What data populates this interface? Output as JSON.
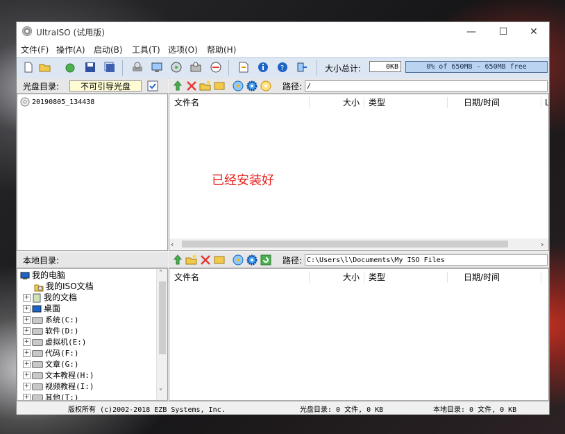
{
  "window": {
    "title": "UltraISO (试用版)",
    "controls": {
      "minimize": "—",
      "maximize": "☐",
      "close": "✕"
    }
  },
  "menu": [
    "文件(F)",
    "操作(A)",
    "启动(B)",
    "工具(T)",
    "选项(O)",
    "帮助(H)"
  ],
  "toolbar": {
    "size_label": "大小总计:",
    "size_value": "0KB",
    "capacity_text": "0% of 650MB - 650MB free",
    "capacity_fill_fraction": 0
  },
  "disc_pane": {
    "label": "光盘目录:",
    "boot_type": "不可引导光盘",
    "root_item": "20190805_134438",
    "path_label": "路径:",
    "path_value": "/",
    "columns": [
      "文件名",
      "大小",
      "类型",
      "日期/时间",
      "L"
    ],
    "overlay_text": "已经安装好"
  },
  "local_pane": {
    "label": "本地目录:",
    "path_label": "路径:",
    "path_value": "C:\\Users\\l\\Documents\\My ISO Files",
    "columns": [
      "文件名",
      "大小",
      "类型",
      "日期/时间"
    ],
    "tree": [
      {
        "label": "我的电脑",
        "indent": 0
      },
      {
        "label": "我的ISO文档",
        "indent": 1
      },
      {
        "label": "我的文档",
        "indent": 1
      },
      {
        "label": "桌面",
        "indent": 1
      },
      {
        "label": "系统(C:)",
        "indent": 1
      },
      {
        "label": "软件(D:)",
        "indent": 1
      },
      {
        "label": "虚拟机(E:)",
        "indent": 1
      },
      {
        "label": "代码(F:)",
        "indent": 1
      },
      {
        "label": "文章(G:)",
        "indent": 1
      },
      {
        "label": "文本教程(H:)",
        "indent": 1
      },
      {
        "label": "视频教程(I:)",
        "indent": 1
      },
      {
        "label": "其他(T:)",
        "indent": 1
      }
    ]
  },
  "status": {
    "copyright": "版权所有 (c)2002-2018 EZB Systems, Inc.",
    "disc_info": "光盘目录: 0 文件, 0 KB",
    "local_info": "本地目录: 0 文件, 0 KB"
  },
  "colors": {
    "overlay_text": "#e8231f",
    "toolbar_bg": "#dde7f3",
    "capacity_bar": "#b9d3f0"
  }
}
